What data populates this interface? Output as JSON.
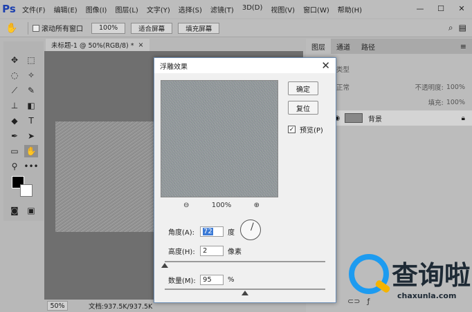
{
  "app": {
    "logo": "Ps"
  },
  "menu": [
    "文件(F)",
    "编辑(E)",
    "图像(I)",
    "图层(L)",
    "文字(Y)",
    "选择(S)",
    "滤镜(T)",
    "3D(D)",
    "视图(V)",
    "窗口(W)",
    "帮助(H)"
  ],
  "window_controls": {
    "minimize": "—",
    "restore": "☐",
    "close": "✕"
  },
  "options": {
    "scroll_all_label": "滚动所有窗口",
    "zoom_btn": "100%",
    "fit_screen_btn": "适合屏幕",
    "fill_screen_btn": "填充屏幕"
  },
  "document": {
    "tab_title": "未标题-1 @ 50%(RGB/8) *",
    "tab_close": "×"
  },
  "status": {
    "zoom": "50%",
    "doc_info": "文档:937.5K/937.5K"
  },
  "panel": {
    "tabs": [
      "图层",
      "通道",
      "路径"
    ],
    "filter_placeholder": "类型",
    "blend_mode": "正常",
    "opacity_label": "不透明度:",
    "opacity_value": "100%",
    "fill_label": "填充:",
    "fill_value": "100%",
    "layer_name": "背景"
  },
  "dialog": {
    "title": "浮雕效果",
    "ok_btn": "确定",
    "reset_btn": "复位",
    "preview_label": "预览(P)",
    "zoom_value": "100%",
    "angle_label": "角度(A):",
    "angle_value": "72",
    "angle_unit": "度",
    "height_label": "高度(H):",
    "height_value": "2",
    "height_unit": "像素",
    "amount_label": "数量(M):",
    "amount_value": "95",
    "amount_unit": "%",
    "height_slider_fraction": 0.0,
    "amount_slider_fraction": 0.5
  },
  "watermark": {
    "text": "查询啦",
    "sub": "chaxunla.com"
  }
}
